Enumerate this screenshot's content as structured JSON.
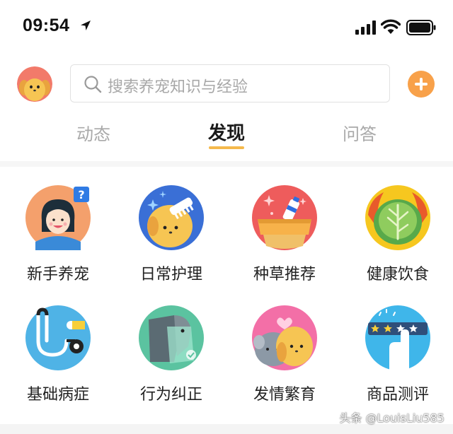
{
  "status_bar": {
    "time": "09:54",
    "icons": [
      "location-arrow-icon",
      "cellular-signal-icon",
      "wifi-icon",
      "battery-icon"
    ]
  },
  "header": {
    "avatar_icon": "dog-avatar-icon",
    "search": {
      "placeholder": "搜索养宠知识与经验",
      "icon": "search-icon"
    },
    "add_icon": "plus-icon",
    "accent_color": "#f8a14a"
  },
  "tabs": [
    {
      "label": "动态",
      "active": false
    },
    {
      "label": "发现",
      "active": true
    },
    {
      "label": "问答",
      "active": false
    }
  ],
  "categories": [
    {
      "label": "新手养宠",
      "icon": "new-owner-icon"
    },
    {
      "label": "日常护理",
      "icon": "daily-care-icon"
    },
    {
      "label": "种草推荐",
      "icon": "recommendation-icon"
    },
    {
      "label": "健康饮食",
      "icon": "healthy-diet-icon"
    },
    {
      "label": "基础病症",
      "icon": "basic-disease-icon"
    },
    {
      "label": "行为纠正",
      "icon": "behavior-correction-icon"
    },
    {
      "label": "发情繁育",
      "icon": "breeding-icon"
    },
    {
      "label": "商品测评",
      "icon": "product-review-icon"
    }
  ],
  "watermark": "头条 @LouisLiu585"
}
